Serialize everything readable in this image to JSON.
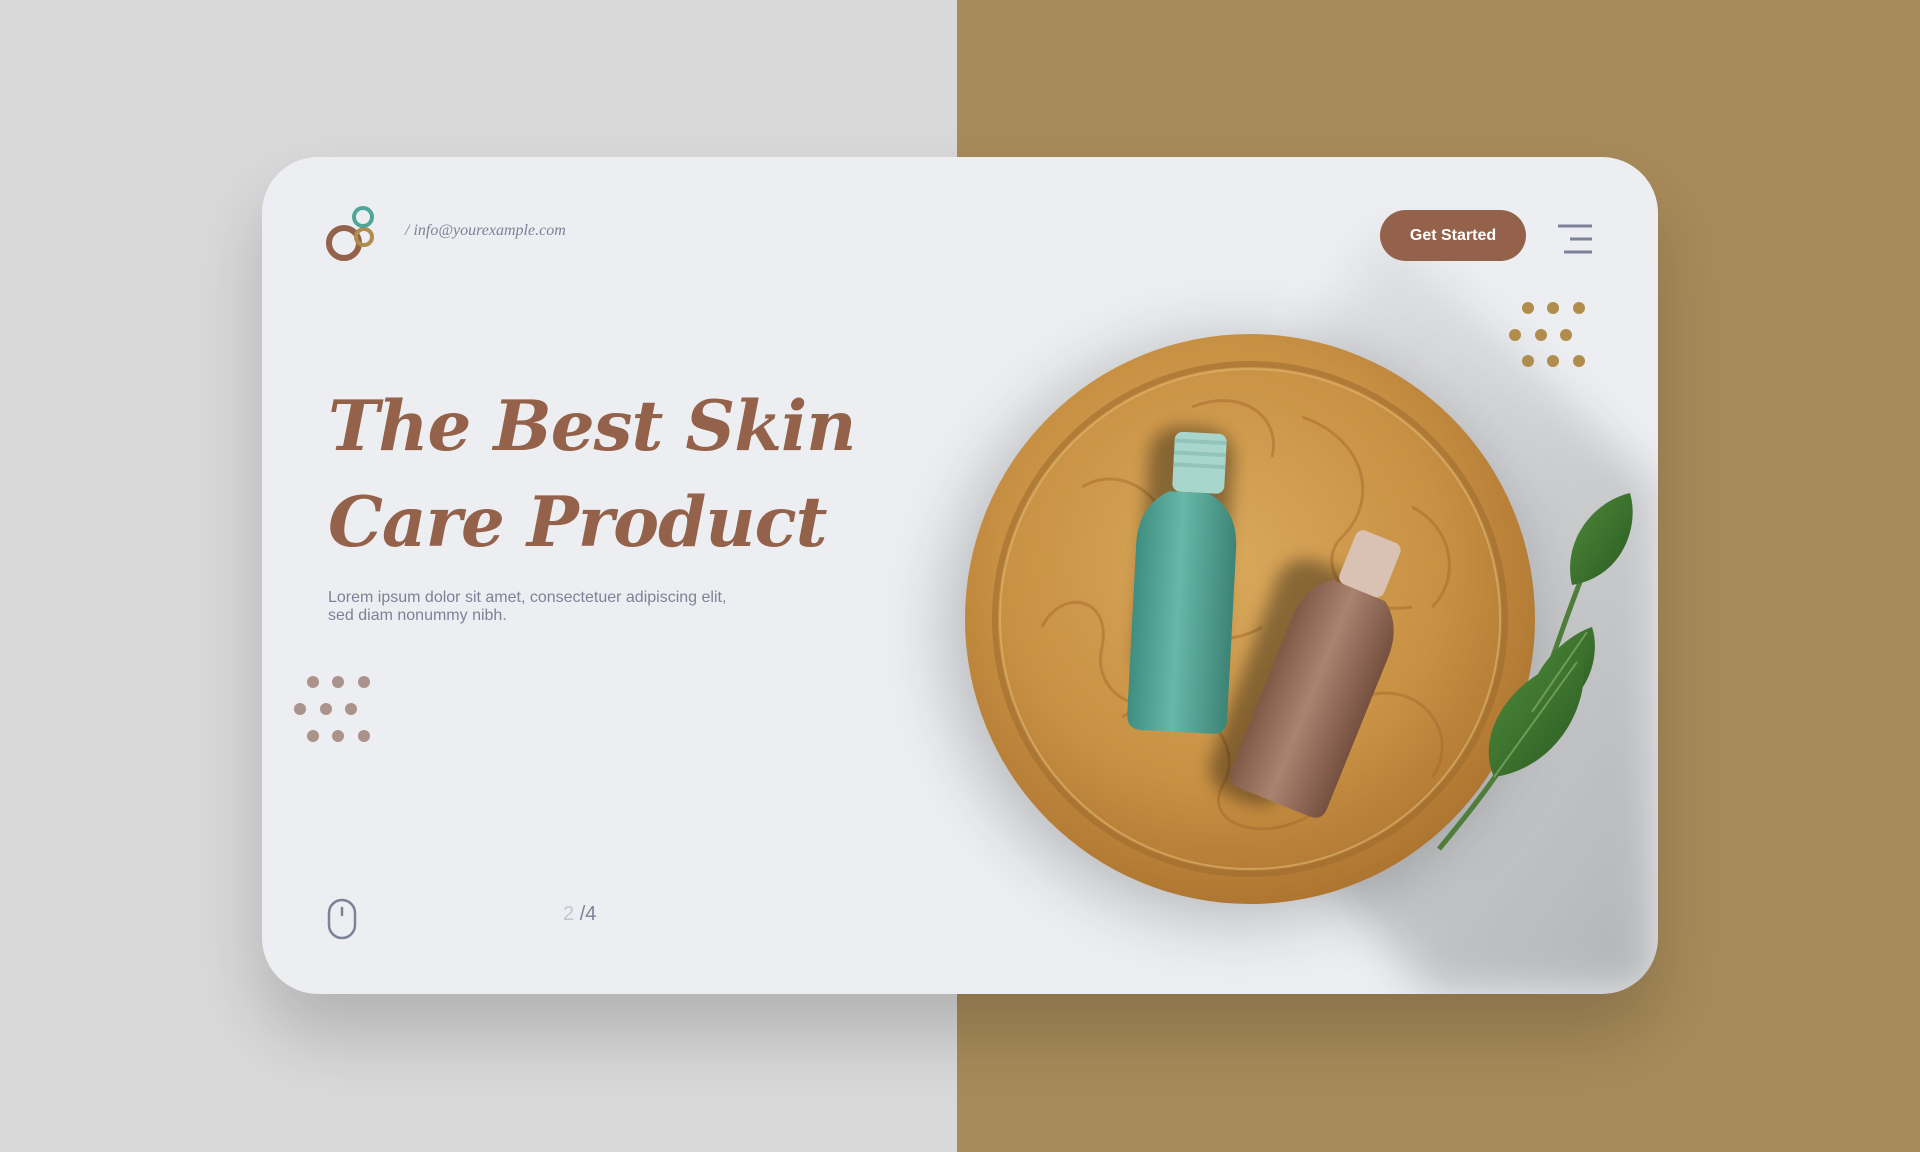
{
  "header": {
    "email": "/ info@yourexample.com",
    "cta_label": "Get Started",
    "logo_icon": "circles-logo-icon",
    "menu_icon": "hamburger-menu-icon"
  },
  "hero": {
    "title_line1": "The Best Skin",
    "title_line2": "Care Product",
    "subtitle": "Lorem ipsum dolor sit amet, consectetuer adipiscing elit, sed diam nonummy nibh."
  },
  "pagination": {
    "current": "2",
    "separator": "/",
    "total": "4"
  },
  "colors": {
    "background_left": "#d9d9d9",
    "background_right": "#a88b5a",
    "card": "#eceef1",
    "brand_brown": "#94624b",
    "text_muted": "#7d8299",
    "teal": "#4fa596",
    "gold": "#b18d4d"
  }
}
